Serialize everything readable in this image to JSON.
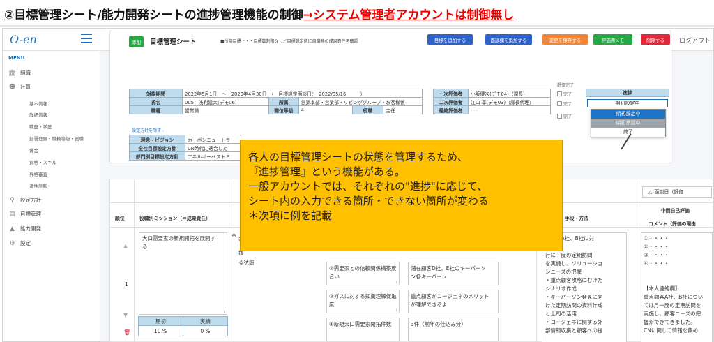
{
  "slide": {
    "heading": "②目標管理シート/能力開発シートの進捗管理機能の制御",
    "heading_note": "→システム管理者アカウントは制御無し"
  },
  "app": {
    "logo": "O-en",
    "logout": "ログアウト"
  },
  "sidebar": {
    "menu_label": "MENU",
    "items": [
      {
        "label": "組織",
        "icon": "building-icon"
      },
      {
        "label": "社員",
        "icon": "users-icon"
      },
      {
        "label": "設定方針",
        "icon": "pin-icon"
      },
      {
        "label": "目標管理",
        "icon": "chart-icon",
        "active": true
      },
      {
        "label": "能力開発",
        "icon": "cap-icon"
      },
      {
        "label": "設定",
        "icon": "gear-icon"
      }
    ],
    "sub_items": [
      "基本情報",
      "詳細情報",
      "職歴・学歴",
      "部署登録・職務等級・役職",
      "賞金",
      "資格・スキル",
      "昇格審査",
      "適性診断"
    ]
  },
  "sheet": {
    "badge": "添削",
    "title": "目標管理シート",
    "hint": "■所期目標・・・目標数制限なし／目標設定前に自職務の成果責任を確認",
    "buttons": [
      {
        "label": "目標を追加する",
        "color": "#2c62c9"
      },
      {
        "label": "面談欄を追加する",
        "color": "#2c62c9"
      },
      {
        "label": "変更を保存する",
        "color": "#f0863a"
      },
      {
        "label": "評価用メモ",
        "color": "#28a745"
      },
      {
        "label": "削除する",
        "color": "#e0283a"
      }
    ],
    "info": {
      "period_label": "対象期間",
      "period_value": "2022年5月1日　～　2023年4月30日　（　目標設定面談日：　2022/05/16　　　）",
      "name_label": "氏名",
      "name_value": "005：浅利建太(デモ06)",
      "dept_label": "所属",
      "dept_value": "営業本部・営業部・リビンググループ・お客様係",
      "job_label": "職種",
      "job_value": "営業職",
      "grade_label": "職位等級",
      "grade_value": "4",
      "role_label": "役職",
      "role_value": "主任",
      "eval1_label": "一次評価者",
      "eval1_value": "小坂健次(デモ04)（課長）",
      "eval2_label": "二次評価者",
      "eval2_value": "江口 享(デモ03)（課長代理）",
      "final_label": "最終評価者",
      "final_value": "----"
    },
    "eval_done": "評価完了",
    "done_label": "完了",
    "progress_label": "進捗",
    "progress_value": "期初設定中",
    "progress_options": [
      "期初設定中",
      "期初承認中",
      "終了"
    ],
    "policy_link": "- 設定方針を隠す -",
    "policy": [
      {
        "label": "理念・ビジョン",
        "value": "カーボンニュートラ"
      },
      {
        "label": "全社目標設定方針",
        "value": "CN時代に適合した"
      },
      {
        "label": "部門別目標設定方針",
        "value": "エネルギーベストミ"
      }
    ]
  },
  "grid": {
    "headers": {
      "no": "順位",
      "mission": "役職別ミッション（＝成果責任）",
      "method": "手段・方法",
      "interview": "面談日（評価",
      "self_eval": "中間自己評価",
      "comment": "コメント（評価の理由"
    },
    "row_no": "1",
    "mission_text": "大口需要家の新規開拓を展開する",
    "goal_partial_1": "各",
    "goal_partial_2": "抜",
    "goal_text": "る状態",
    "sub_items": [
      {
        "text": "②需要家との信頼関係構築度合い",
        "detail": "潜在顧客D社、E社のキーパーソン各キーパーソ"
      },
      {
        "text": "③ガスに対する知識理解促進度",
        "detail": "重点顧客がコージェネのメリットが理解できるよ"
      },
      {
        "text": "④新規大口需要家開拓件数",
        "detail": "3件（前年の仕込み分）"
      }
    ],
    "method_lines": [
      "己顧客A社、B社に対",
      "る",
      "行に一度の定期訪問",
      "を実施し、ソリューショ",
      "ンニーズの把握",
      "・重点顧客攻略にむけた",
      "シナリオ作成",
      "・キーパーソン発見に向",
      "けた定期訪問の資料作成",
      "と上司の活用",
      "・コージェネに関する外",
      "部情報収集と顧客への提"
    ],
    "comment_lines": [
      "①・・・・",
      "②・・・・",
      "③・・・・",
      "④・・・・",
      "",
      "【本人連絡欄】",
      "重点顧客A社、B社につい",
      "ては月一度の定期訪問を",
      "実施し、顧客ニーズの把",
      "握ができてきました。",
      "CNに関して情報を集め"
    ],
    "pct": {
      "plan_label": "期初",
      "actual_label": "実績",
      "plan_value": "10",
      "actual_value": "0",
      "unit": "%"
    }
  },
  "callout": {
    "lines": [
      "各人の目標管理シートの状態を管理するため、",
      "『進捗管理』という機能がある。",
      "一般アカウントでは、それぞれの\"進捗\"に応じて、",
      "シート内の入力できる箇所・できない箇所が変わる",
      "＊次項に例を記載"
    ]
  }
}
